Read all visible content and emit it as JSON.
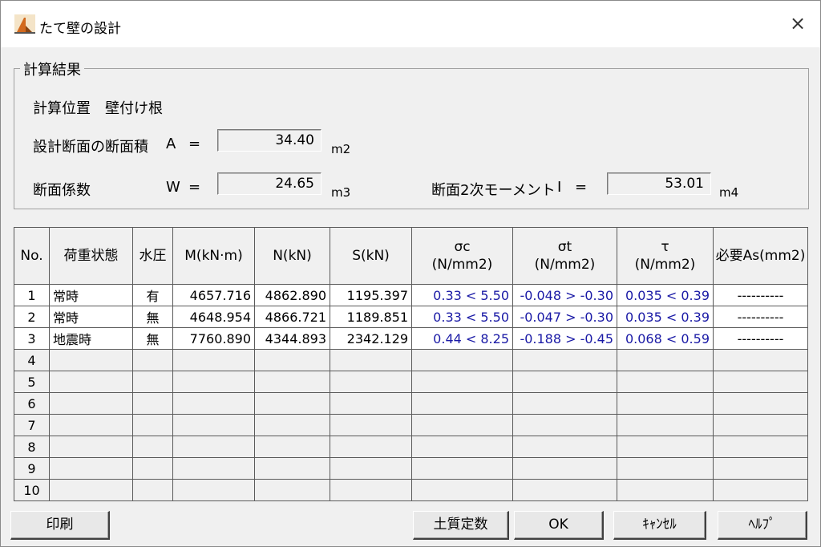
{
  "window": {
    "title": "たて壁の設計",
    "close_icon": "×"
  },
  "group": {
    "legend": "計算結果"
  },
  "calc_position": {
    "label": "計算位置",
    "value": "壁付け根"
  },
  "area": {
    "label": "設計断面の断面積",
    "symbol": "A",
    "eq": "=",
    "value": "34.40",
    "unit": "m2"
  },
  "modulus": {
    "label": "断面係数",
    "symbol": "W",
    "eq": "=",
    "value": "24.65",
    "unit": "m3"
  },
  "moment2": {
    "label": "断面2次モーメント",
    "symbol": "I",
    "eq": "=",
    "value": "53.01",
    "unit": "m4"
  },
  "table": {
    "headers": {
      "no": "No.",
      "case": "荷重状態",
      "water": "水圧",
      "m": "M(kN·m)",
      "n": "N(kN)",
      "s": "S(kN)",
      "sc_sym": "σc",
      "sc_unit": "(N/mm2)",
      "st_sym": "σt",
      "st_unit": "(N/mm2)",
      "tau_sym": "τ",
      "tau_unit": "(N/mm2)",
      "as": "必要As(mm2)"
    },
    "rows": [
      {
        "no": "1",
        "case": "常時",
        "water": "有",
        "m": "4657.716",
        "n": "4862.890",
        "s": "1195.397",
        "sc": "0.33 < 5.50",
        "st": "-0.048 > -0.30",
        "tau": "0.035 < 0.39",
        "as": "----------"
      },
      {
        "no": "2",
        "case": "常時",
        "water": "無",
        "m": "4648.954",
        "n": "4866.721",
        "s": "1189.851",
        "sc": "0.33 < 5.50",
        "st": "-0.047 > -0.30",
        "tau": "0.035 < 0.39",
        "as": "----------"
      },
      {
        "no": "3",
        "case": "地震時",
        "water": "無",
        "m": "7760.890",
        "n": "4344.893",
        "s": "2342.129",
        "sc": "0.44 < 8.25",
        "st": "-0.188 > -0.45",
        "tau": "0.068 < 0.59",
        "as": "----------"
      },
      {
        "no": "4"
      },
      {
        "no": "5"
      },
      {
        "no": "6"
      },
      {
        "no": "7"
      },
      {
        "no": "8"
      },
      {
        "no": "9"
      },
      {
        "no": "10"
      }
    ]
  },
  "buttons": {
    "print": "印刷",
    "soil": "土質定数",
    "ok": "OK",
    "cancel": "ｷｬﾝｾﾙ",
    "help": "ﾍﾙﾌﾟ"
  },
  "colors": {
    "value_blue": "#1a1aa6"
  }
}
